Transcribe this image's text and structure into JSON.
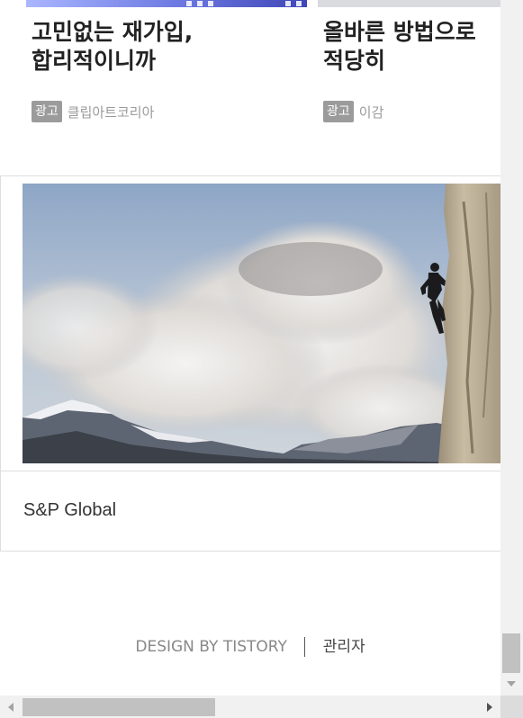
{
  "ads": [
    {
      "title": "고민없는 재가입,\n합리적이니까",
      "badge": "광고",
      "sponsor": "클립아트코리아"
    },
    {
      "title": "올바른 방법으로\n적당히",
      "badge": "광고",
      "sponsor": "이감"
    }
  ],
  "display_ad": {
    "brand": "S&P Global",
    "image": "rock-climber-clouds-mountains"
  },
  "footer": {
    "design_credit": "DESIGN BY TISTORY",
    "admin_link": "관리자"
  },
  "icons": {
    "scroll_down": "triangle-down-icon",
    "scroll_left": "triangle-left-icon",
    "scroll_right": "triangle-right-icon"
  }
}
